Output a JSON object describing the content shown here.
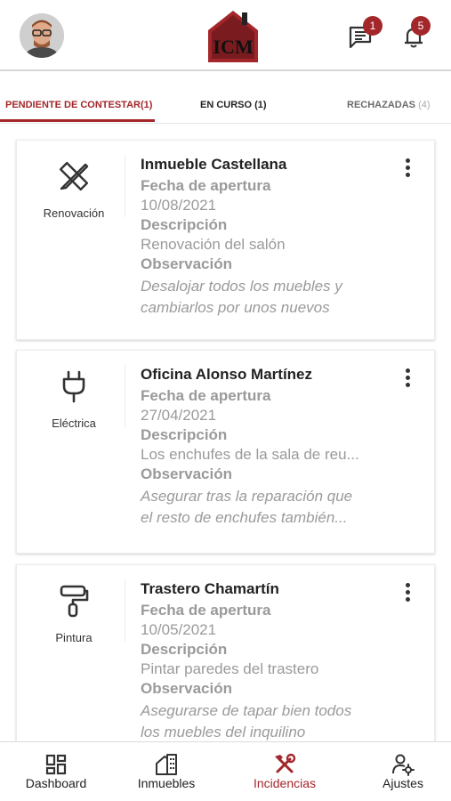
{
  "header": {
    "message_badge": "1",
    "notification_badge": "5",
    "logo_text": "ICM"
  },
  "tabs": [
    {
      "label": "PENDIENTE DE CONTESTAR(1)"
    },
    {
      "label": "EN CURSO (1)"
    },
    {
      "label": "RECHAZADAS",
      "count": "(4)"
    }
  ],
  "cards": [
    {
      "category": "Renovación",
      "category_icon": "pencil-ruler-icon",
      "title": "Inmueble Castellana",
      "date_label": "Fecha de apertura",
      "date": "10/08/2021",
      "desc_label": "Descripción",
      "desc": "Renovación del salón",
      "obs_label": "Observación",
      "obs": "Desalojar todos los muebles y\ncambiarlos por unos nuevos"
    },
    {
      "category": "Eléctrica",
      "category_icon": "plug-icon",
      "title": "Oficina Alonso Martínez",
      "date_label": "Fecha de apertura",
      "date": "27/04/2021",
      "desc_label": "Descripción",
      "desc": "Los enchufes de la sala de reu...",
      "obs_label": "Observación",
      "obs": "Asegurar tras la reparación que\n el resto de enchufes también..."
    },
    {
      "category": "Pintura",
      "category_icon": "paint-roller-icon",
      "title": "Trastero Chamartín",
      "date_label": "Fecha de apertura",
      "date": "10/05/2021",
      "desc_label": "Descripción",
      "desc": "Pintar paredes del trastero",
      "obs_label": "Observación",
      "obs": "Asegurarse de tapar bien todos\nlos muebles del inquilino"
    }
  ],
  "nav": [
    {
      "label": "Dashboard",
      "icon": "dashboard-icon"
    },
    {
      "label": "Inmuebles",
      "icon": "building-icon"
    },
    {
      "label": "Incidencias",
      "icon": "tools-icon",
      "active": true
    },
    {
      "label": "Ajustes",
      "icon": "user-settings-icon"
    }
  ],
  "colors": {
    "accent": "#a3262a",
    "muted_text": "#9a9a9a"
  }
}
